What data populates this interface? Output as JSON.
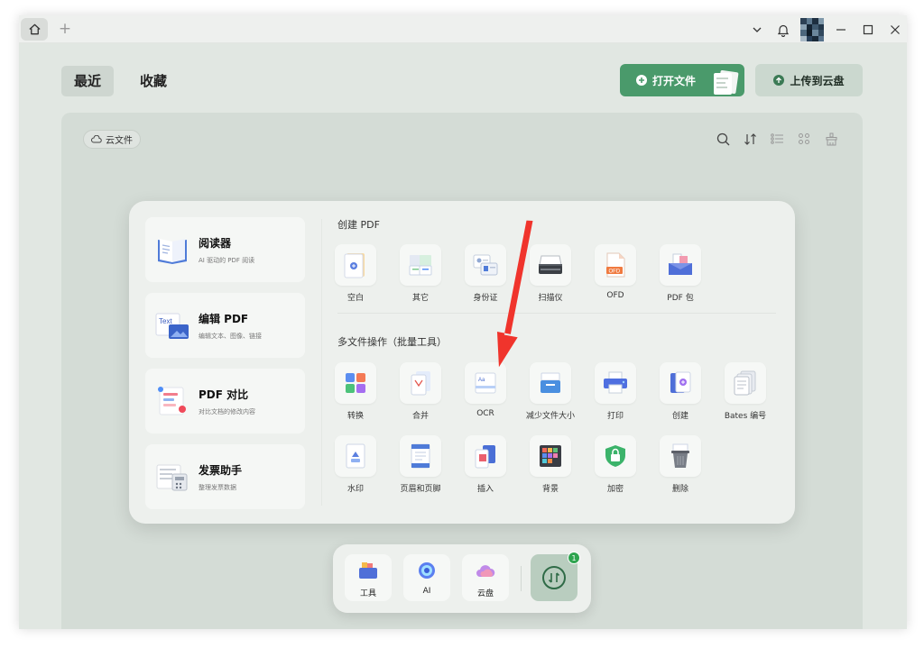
{
  "titlebar": {
    "home_icon": "home-icon",
    "new_tab": "+",
    "controls": [
      "chevron-down-icon",
      "bell-icon",
      "avatar",
      "minimize-icon",
      "maximize-icon",
      "close-icon"
    ]
  },
  "tabs": [
    {
      "label": "最近",
      "active": true
    },
    {
      "label": "收藏",
      "active": false
    }
  ],
  "actions": {
    "open_label": "打开文件",
    "upload_label": "上传到云盘"
  },
  "filter": {
    "cloud_chip": "云文件"
  },
  "panel": {
    "cards": [
      {
        "title": "阅读器",
        "subtitle": "AI 驱动的 PDF 阅读",
        "icon": "book-icon"
      },
      {
        "title": "编辑 PDF",
        "subtitle": "编辑文本、图像、链接",
        "icon": "text-edit-icon"
      },
      {
        "title": "PDF 对比",
        "subtitle": "对比文档的修改内容",
        "icon": "compare-icon"
      },
      {
        "title": "发票助手",
        "subtitle": "整理发票数据",
        "icon": "invoice-icon"
      }
    ],
    "create_title": "创建 PDF",
    "create_tools": [
      "空白",
      "其它",
      "身份证",
      "扫描仪",
      "OFD",
      "PDF 包"
    ],
    "batch_title": "多文件操作（批量工具）",
    "batch_tools_row1": [
      "转换",
      "合并",
      "OCR",
      "减少文件大小",
      "打印",
      "创建",
      "Bates 编号"
    ],
    "batch_tools_row2": [
      "水印",
      "页眉和页脚",
      "插入",
      "背景",
      "加密",
      "删除"
    ]
  },
  "dock": {
    "items": [
      "工具",
      "AI",
      "云盘"
    ],
    "badge": "1"
  },
  "colors": {
    "accent_green": "#4a9a6b",
    "annotation_arrow": "#f0342c"
  }
}
